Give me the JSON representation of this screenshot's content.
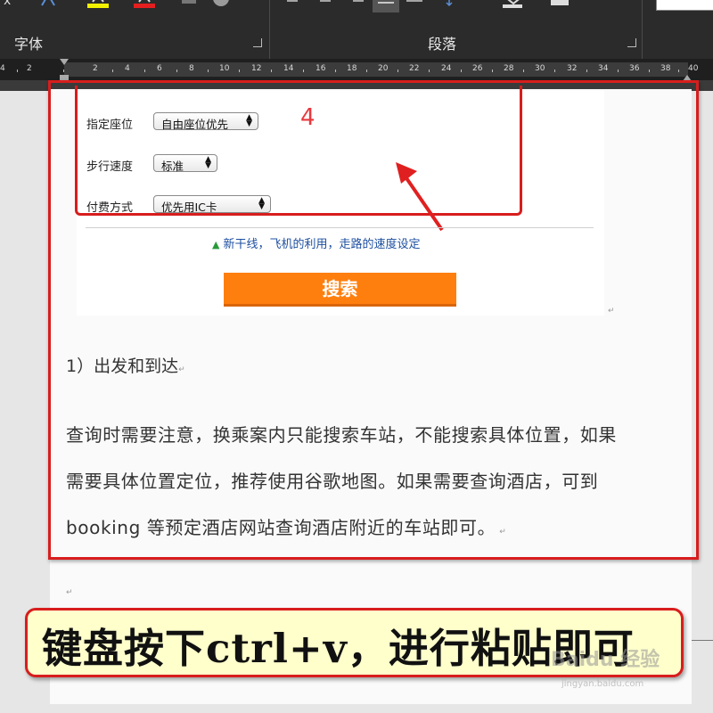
{
  "ribbon": {
    "groups": [
      {
        "label": "字体"
      },
      {
        "label": "段落"
      }
    ],
    "close_glyph": "x"
  },
  "ruler": {
    "labels": [
      "4",
      "2",
      "2",
      "4",
      "6",
      "8",
      "10",
      "12",
      "14",
      "16",
      "18",
      "20",
      "22",
      "24",
      "26",
      "28",
      "30",
      "32",
      "34",
      "36",
      "38",
      "40"
    ]
  },
  "embedded_screenshot": {
    "step_number": "4",
    "fields": [
      {
        "label": "指定座位",
        "value": "自由座位优先"
      },
      {
        "label": "步行速度",
        "value": "标准"
      },
      {
        "label": "付费方式",
        "value": "优先用IC卡"
      }
    ],
    "link_text": "新干线，飞机的利用，走路的速度设定",
    "search_button": "搜索"
  },
  "document": {
    "heading": "1）出发和到达",
    "body_lines": [
      "查询时需要注意，换乘案内只能搜索车站，不能搜索具体位置，如果",
      "需要具体位置定位，推荐使用谷歌地图。如果需要查询酒店，可到",
      "booking 等预定酒店网站查询酒店附近的车站即可。"
    ],
    "paragraph_mark": "↵"
  },
  "caption": {
    "text": "键盘按下ctrl+v，进行粘贴即可"
  },
  "watermark": {
    "text": "Baidu 经验",
    "sub": "jingyan.baidu.com"
  },
  "colors": {
    "accent_red": "#d81d1d",
    "button_orange": "#ff7f0e",
    "caption_bg": "#ffffcc",
    "link_blue": "#1d4fa0"
  }
}
